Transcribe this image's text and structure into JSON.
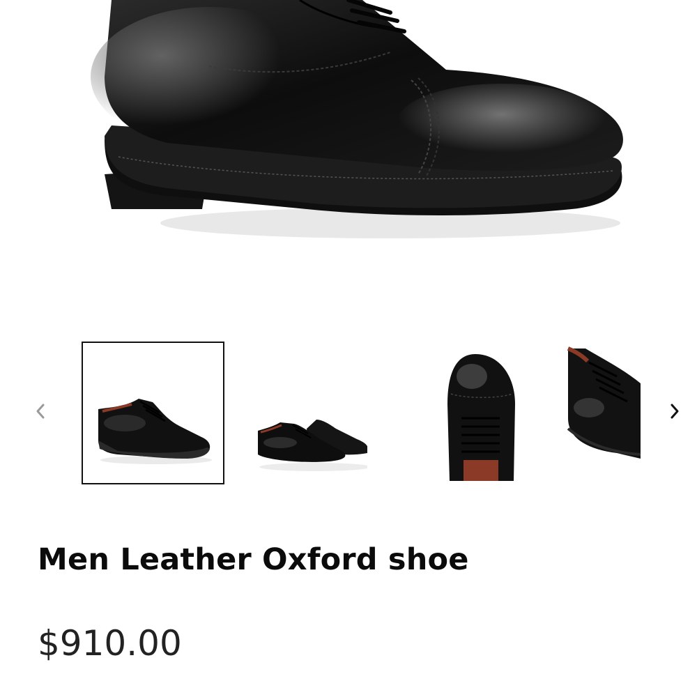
{
  "product": {
    "title": "Men Leather Oxford shoe",
    "price": "$910.00"
  },
  "hero_image": {
    "alt": "Black leather Oxford shoe close-up"
  },
  "gallery": {
    "prev_icon": "chevron-left-icon",
    "next_icon": "chevron-right-icon",
    "selected_index": 0,
    "thumbnails": [
      {
        "view": "side view"
      },
      {
        "view": "pair view"
      },
      {
        "view": "top view"
      },
      {
        "view": "detail view"
      }
    ]
  },
  "colors": {
    "leather": "#111111",
    "sole": "#1a1a1a",
    "lining": "#8a3a26",
    "arrow_inactive": "#9a9a9a",
    "arrow_active": "#111111",
    "selected_border": "#111111"
  }
}
